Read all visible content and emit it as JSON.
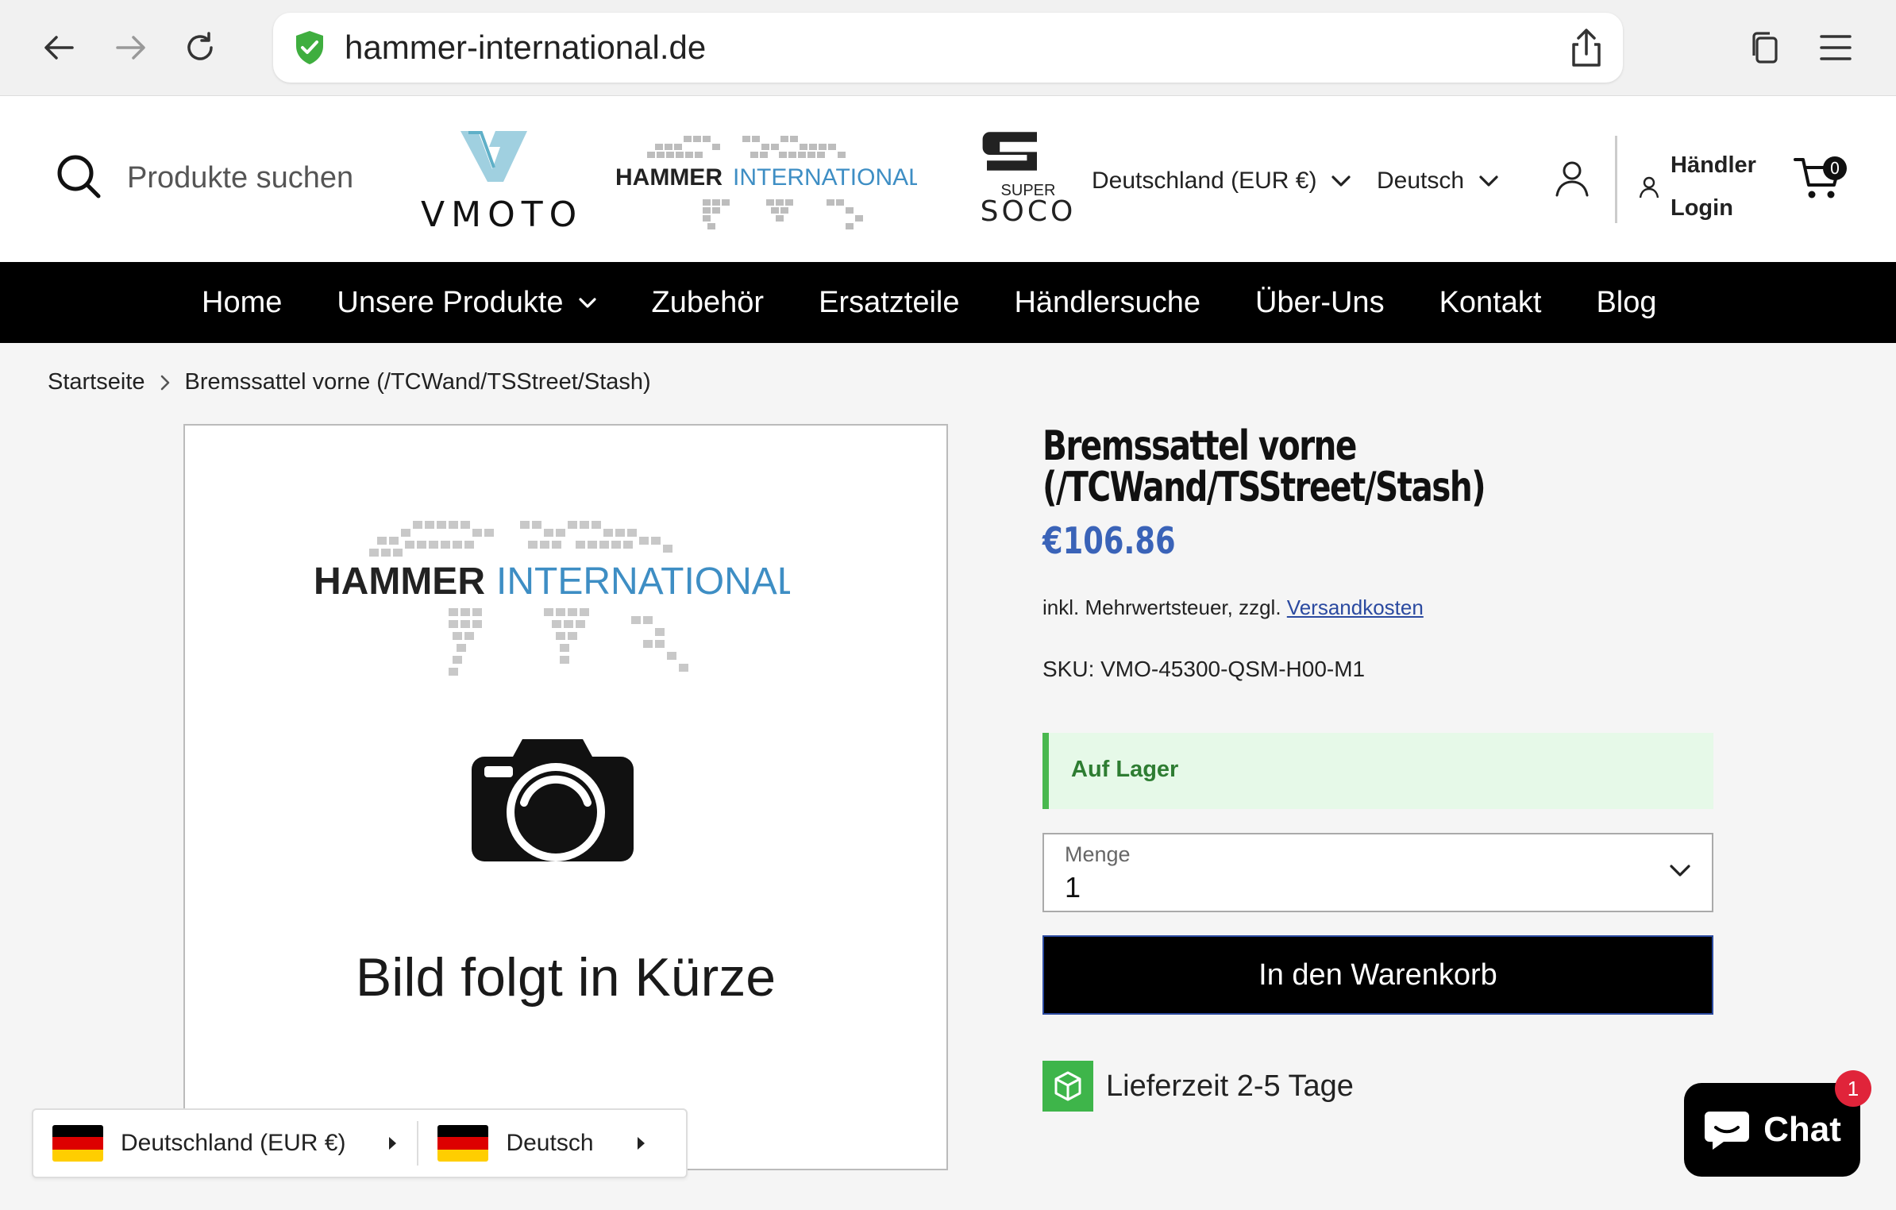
{
  "browser": {
    "url": "hammer-international.de"
  },
  "header": {
    "search_placeholder": "Produkte suchen",
    "logo_vmoto_text": "VMOTO",
    "logo_hammer_left": "HAMMER",
    "logo_hammer_right": "INTERNATIONAL",
    "logo_soco_super": "SUPER",
    "logo_soco_text": "SOCO",
    "region": "Deutschland (EUR €)",
    "language": "Deutsch",
    "dealer_line1": "Händler",
    "dealer_line2": "Login",
    "cart_count": "0"
  },
  "nav": {
    "items": [
      "Home",
      "Unsere Produkte",
      "Zubehör",
      "Ersatzteile",
      "Händlersuche",
      "Über-Uns",
      "Kontakt",
      "Blog"
    ]
  },
  "breadcrumb": {
    "home": "Startseite",
    "current": "Bremssattel vorne (/TCWand/TSStreet/Stash)"
  },
  "image_panel": {
    "logo_left": "HAMMER",
    "logo_right": "INTERNATIONAL",
    "caption": "Bild folgt in Kürze"
  },
  "product": {
    "title": "Bremssattel vorne (/TCWand/TSStreet/Stash)",
    "price": "€106.86",
    "tax_prefix": "inkl. Mehrwertsteuer, zzgl.",
    "tax_link": "Versandkosten",
    "sku": "SKU: VMO-45300-QSM-H00-M1",
    "stock": "Auf Lager",
    "qty_label": "Menge",
    "qty_value": "1",
    "add_to_cart": "In den Warenkorb",
    "delivery": "Lieferzeit 2-5 Tage"
  },
  "locale_bar": {
    "region": "Deutschland (EUR €)",
    "language": "Deutsch"
  },
  "chat": {
    "label": "Chat",
    "badge": "1"
  },
  "colors": {
    "accent_blue": "#3a63b8",
    "stock_green": "#49b84f",
    "nav_bg": "#000000",
    "badge_red": "#e0243a"
  }
}
